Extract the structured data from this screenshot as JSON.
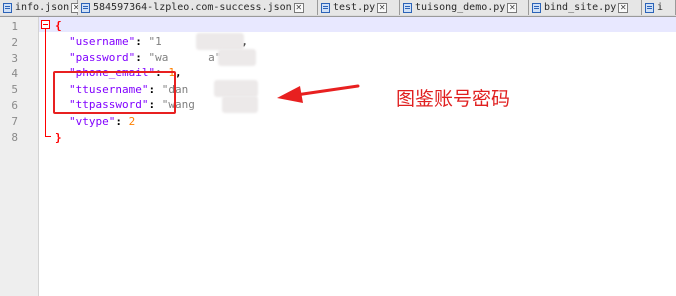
{
  "tabs": [
    {
      "label": "info.json",
      "active": false
    },
    {
      "label": "584597364-lzpleo.com-success.json",
      "active": false
    },
    {
      "label": "test.py",
      "active": false
    },
    {
      "label": "tuisong_demo.py",
      "active": false
    },
    {
      "label": "bind_site.py",
      "active": false
    },
    {
      "label": "i",
      "active": false
    }
  ],
  "line_numbers": [
    "1",
    "2",
    "3",
    "4",
    "5",
    "6",
    "7",
    "8"
  ],
  "code": {
    "open_brace": "{",
    "username_key": "\"username\"",
    "username_value": "\"1        629\"",
    "password_key": "\"password\"",
    "password_value": "\"wa      a\"",
    "phone_email_key": "\"phone_email\"",
    "phone_email_value": "1",
    "ttusername_key": "\"ttusername\"",
    "ttusername_value": "\"dan     eo\"",
    "ttpassword_key": "\"ttpassword\"",
    "ttpassword_value": "\"wang     \"",
    "vtype_key": "\"vtype\"",
    "vtype_value": "2",
    "close_brace": "}"
  },
  "annotation": {
    "text": "图鉴账号密码",
    "color": "#e02020"
  },
  "colors": {
    "key": "#8000ff",
    "string": "#808080",
    "number": "#ff8000",
    "brace": "#ff0000",
    "current_line": "#e8e8ff"
  }
}
